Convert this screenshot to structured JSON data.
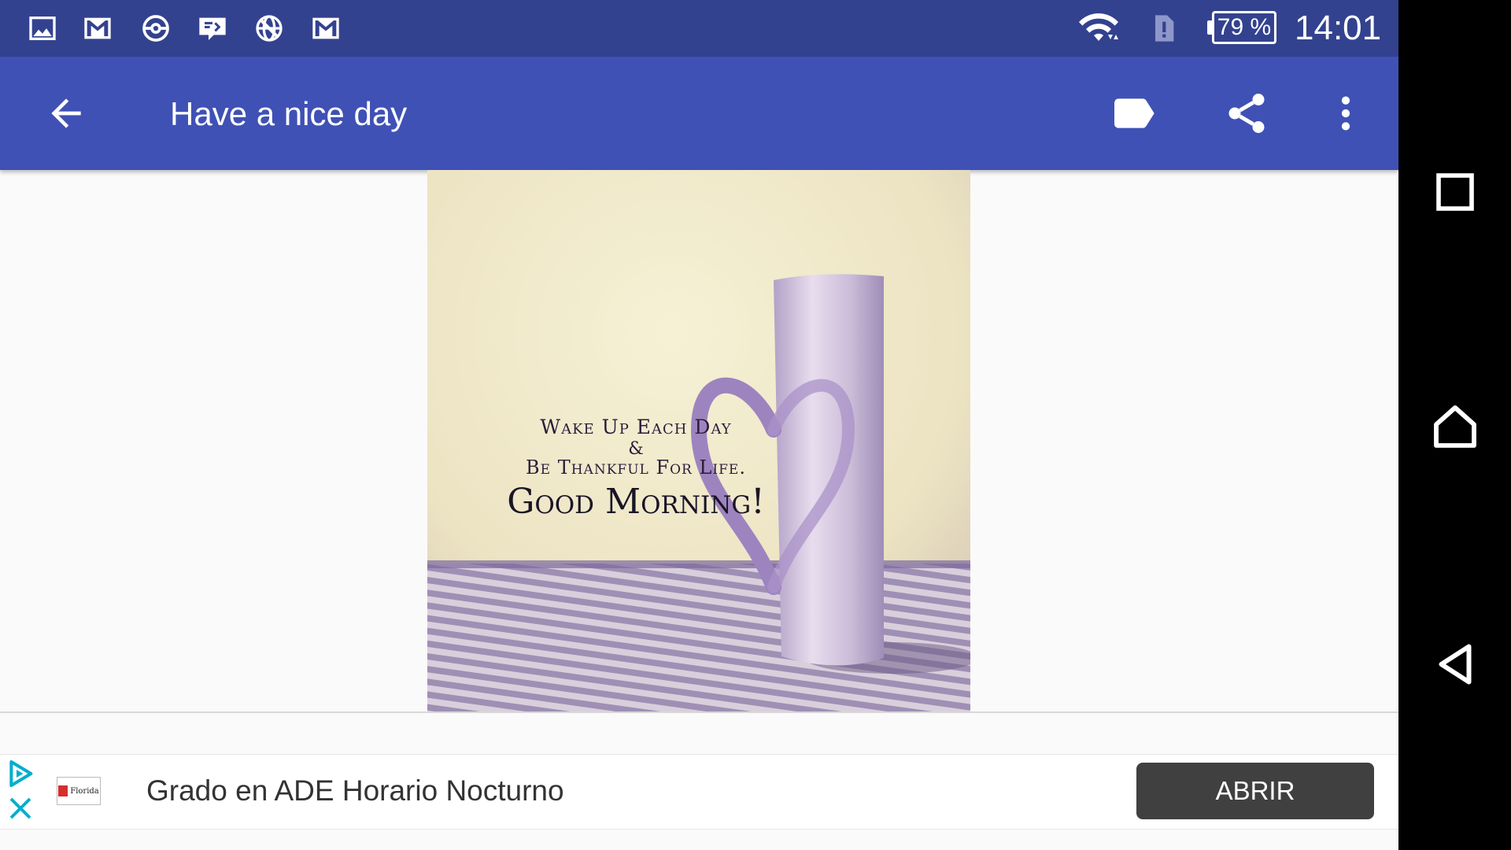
{
  "status_bar": {
    "icons": [
      "gallery-icon",
      "gmail-icon",
      "pokeball-icon",
      "chat-icon",
      "vpn-globe-icon",
      "gmail-icon",
      "wifi-icon",
      "sim-alert-icon",
      "battery-icon"
    ],
    "battery_label": "79 %",
    "clock": "14:01"
  },
  "toolbar": {
    "title": "Have a nice day",
    "back_icon": "arrow-back-icon",
    "actions": [
      "label-icon",
      "share-icon",
      "more-vert-icon"
    ],
    "color": "#3f51b5"
  },
  "image": {
    "line1": "Wake Up Each Day",
    "line2": "&",
    "line3": "Be Thankful For Life.",
    "line4": "Good Morning!"
  },
  "ad": {
    "logo_text": "Florida",
    "headline": "Grado en ADE Horario Nocturno",
    "cta": "ABRIR",
    "cta_color": "#404040"
  },
  "nav_bar": {
    "buttons": [
      "recents-square-icon",
      "home-icon",
      "back-triangle-icon"
    ]
  }
}
